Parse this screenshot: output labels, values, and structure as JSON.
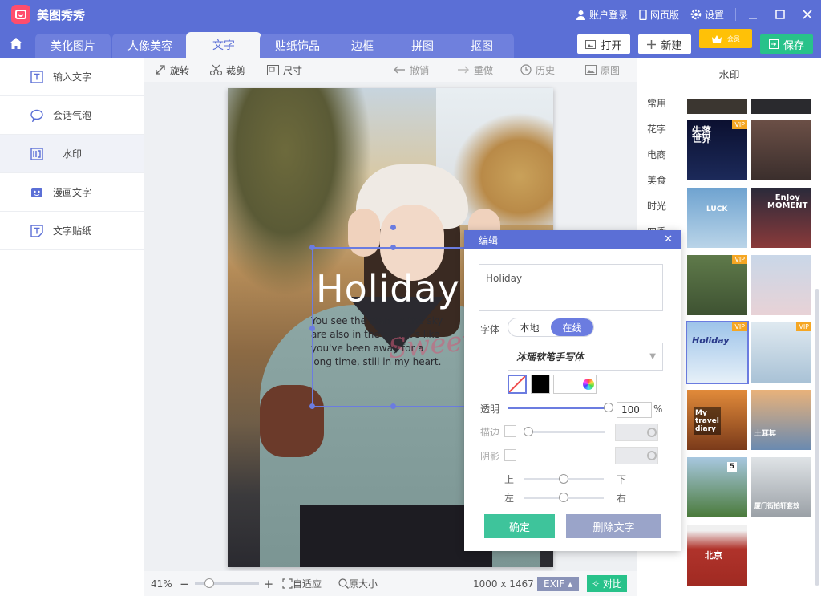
{
  "app": {
    "name": "美图秀秀"
  },
  "titlebar": {
    "account": "账户登录",
    "web": "网页版",
    "settings": "设置"
  },
  "tabs": [
    {
      "label": "美化图片"
    },
    {
      "label": "人像美容"
    },
    {
      "label": "文字"
    },
    {
      "label": "贴纸饰品"
    },
    {
      "label": "边框"
    },
    {
      "label": "拼图"
    },
    {
      "label": "抠图"
    }
  ],
  "actions": {
    "open": "打开",
    "new": "新建",
    "vip": "会员",
    "save": "保存"
  },
  "sidebar": {
    "items": [
      {
        "label": "输入文字"
      },
      {
        "label": "会话气泡"
      },
      {
        "label": "水印"
      },
      {
        "label": "漫画文字"
      },
      {
        "label": "文字贴纸"
      }
    ]
  },
  "toolbar": {
    "rotate": "旋转",
    "crop": "裁剪",
    "size": "尺寸",
    "undo": "撤销",
    "redo": "重做",
    "history": "历史",
    "original": "原图"
  },
  "watermark": {
    "title": "Holiday",
    "body": "You see the stars in the sky are also in the sea. It's like you've been away for a long time, still in my heart.",
    "script": "Sweet"
  },
  "status": {
    "zoom": "41%",
    "fit": "自适应",
    "actual": "原大小",
    "dims": "1000 x 1467",
    "exif": "EXIF",
    "compare": "对比"
  },
  "right_panel": {
    "title": "水印",
    "categories": [
      "常用",
      "花字",
      "电商",
      "美食",
      "时光",
      "四季"
    ],
    "thumbs": [
      {
        "text": "失落\n世界",
        "vip": "VIP"
      },
      {
        "text": "",
        "vip": ""
      },
      {
        "text": "LUCK",
        "vip": ""
      },
      {
        "text": "EnJoy\nMOMENT",
        "vip": ""
      },
      {
        "text": "",
        "vip": "VIP"
      },
      {
        "text": "",
        "vip": ""
      },
      {
        "text": "Holiday",
        "vip": "VIP"
      },
      {
        "text": "",
        "vip": "VIP"
      },
      {
        "text": "My\ntravel\ndiary",
        "vip": ""
      },
      {
        "text": "土耳其",
        "vip": ""
      },
      {
        "text": "5",
        "vip": ""
      },
      {
        "text": "厦门街拍轩套效",
        "vip": ""
      },
      {
        "text": "北京",
        "vip": ""
      }
    ]
  },
  "dialog": {
    "title": "编辑",
    "text_value": "Holiday",
    "font_label": "字体",
    "local": "本地",
    "online": "在线",
    "font_name": "沐瑶软笔手写体",
    "opacity_label": "透明",
    "opacity_value": "100",
    "percent": "%",
    "stroke_label": "描边",
    "shadow_label": "阴影",
    "up": "上",
    "down": "下",
    "left": "左",
    "right": "右",
    "ok": "确定",
    "delete": "删除文字"
  }
}
